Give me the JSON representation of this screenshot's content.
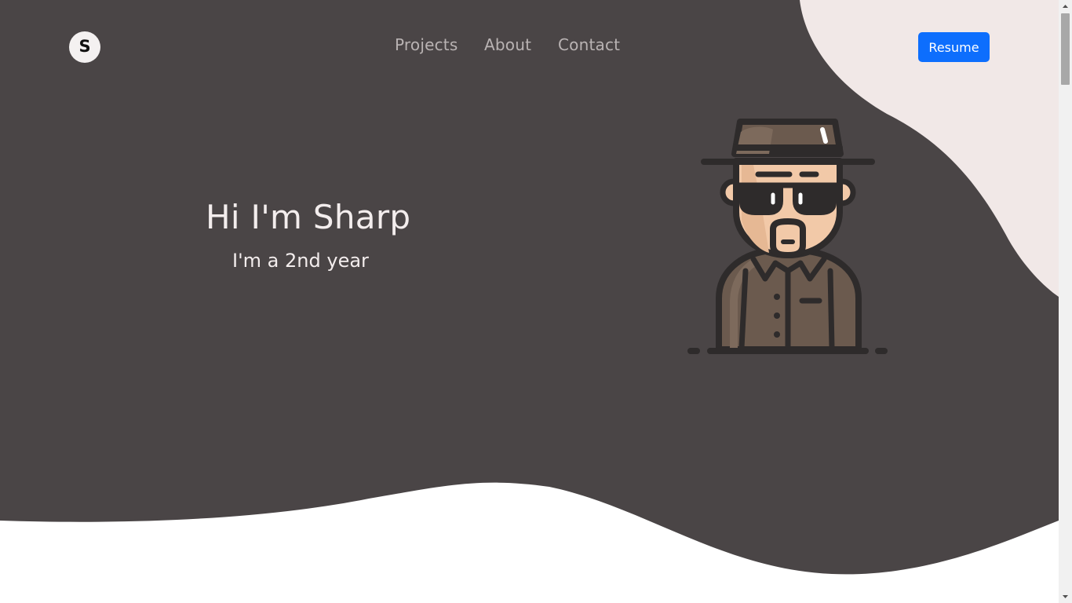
{
  "logo": {
    "letter": "S"
  },
  "nav": {
    "items": [
      {
        "label": "Projects"
      },
      {
        "label": "About"
      },
      {
        "label": "Contact"
      }
    ]
  },
  "header": {
    "resume_label": "Resume"
  },
  "hero": {
    "title": "Hi I'm Sharp",
    "subtitle": "I'm a 2nd year"
  },
  "colors": {
    "background": "#4a4546",
    "blob": "#f1e8e7",
    "wave": "#ffffff",
    "accent": "#0d6efd",
    "nav_text": "#b9b3b3",
    "hero_text": "#f3eded"
  },
  "icons": {
    "avatar": "detective-avatar-icon",
    "scroll_up": "arrow-up-icon",
    "scroll_down": "arrow-down-icon"
  }
}
